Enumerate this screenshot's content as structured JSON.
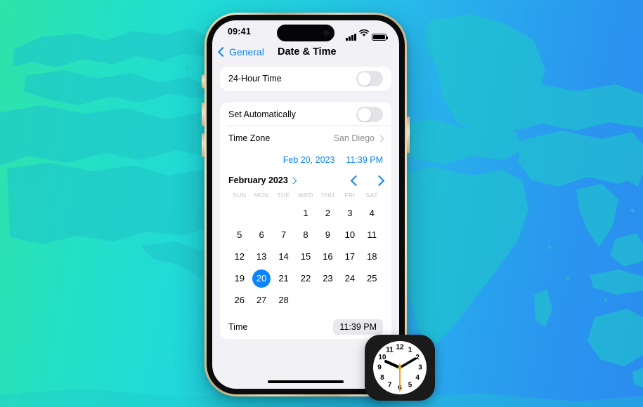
{
  "background": {
    "name": "world-map-gradient",
    "gradient_start": "#2fe3a8",
    "gradient_end": "#2b8cef",
    "land_color": "#1fbfc9"
  },
  "phone": {
    "frame_color": "#d8c49a",
    "status_bar": {
      "time": "09:41",
      "signal_icon": "cellular-signal-icon",
      "wifi_icon": "wifi-icon",
      "battery_icon": "battery-icon"
    },
    "nav": {
      "back_label": "General",
      "back_icon": "chevron-left-icon",
      "title": "Date & Time"
    }
  },
  "settings": {
    "hour_format_row": {
      "label": "24-Hour Time",
      "toggle_state": "off"
    },
    "set_automatically_row": {
      "label": "Set Automatically",
      "toggle_state": "off"
    },
    "time_zone_row": {
      "label": "Time Zone",
      "value": "San Diego",
      "chevron_icon": "chevron-right-icon"
    },
    "date_time_selector": {
      "date": "Feb 20, 2023",
      "time": "11:39 PM",
      "accent_color": "#0a84ff"
    },
    "time_row": {
      "label": "Time",
      "value": "11:39 PM"
    }
  },
  "calendar": {
    "month_label": "February 2023",
    "month_chevron_icon": "chevron-right-icon",
    "prev_icon": "chevron-left-icon",
    "next_icon": "chevron-right-icon",
    "weekdays": [
      "SUN",
      "MON",
      "TUE",
      "WED",
      "THU",
      "FRI",
      "SAT"
    ],
    "leading_blanks": 3,
    "days": [
      1,
      2,
      3,
      4,
      5,
      6,
      7,
      8,
      9,
      10,
      11,
      12,
      13,
      14,
      15,
      16,
      17,
      18,
      19,
      20,
      21,
      22,
      23,
      24,
      25,
      26,
      27,
      28
    ],
    "selected_day": 20,
    "selected_color": "#0a84ff"
  },
  "clock_icon": {
    "name": "clock-app-icon",
    "face_color": "#ffffff",
    "body_color": "#1a1a1a",
    "second_hand_color": "#f5a623",
    "hour_numerals": [
      "12",
      "1",
      "2",
      "3",
      "4",
      "5",
      "6",
      "7",
      "8",
      "9",
      "10",
      "11"
    ],
    "hour_hand_points_to": 10,
    "minute_hand_points_to": 2,
    "second_hand_points_to": 6
  }
}
